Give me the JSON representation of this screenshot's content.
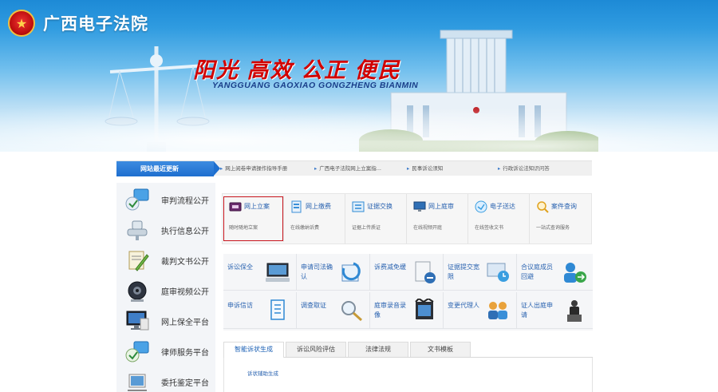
{
  "header": {
    "site_title": "广西电子法院",
    "slogan": "阳光 高效 公正 便民",
    "slogan_pinyin": "YANGGUANG  GAOXIAO GONGZHENG BIANMIN",
    "emblem_icon": "court-emblem-icon"
  },
  "notice_bar": {
    "label": "网站最近更新",
    "items": [
      "网上阅卷申请操作指导手册",
      "广西电子法院网上立案指...",
      "民事诉讼须知",
      "行政诉讼法知识问答"
    ]
  },
  "sidebar": {
    "items": [
      {
        "label": "审判流程公开",
        "icon": "trial-process-icon"
      },
      {
        "label": "执行信息公开",
        "icon": "execution-info-icon"
      },
      {
        "label": "裁判文书公开",
        "icon": "judgment-document-icon"
      },
      {
        "label": "庭审视频公开",
        "icon": "trial-video-icon"
      },
      {
        "label": "网上保全平台",
        "icon": "online-preservation-icon"
      },
      {
        "label": "律师服务平台",
        "icon": "lawyer-service-icon"
      },
      {
        "label": "委托鉴定平台",
        "icon": "appraisal-platform-icon"
      }
    ]
  },
  "services": [
    {
      "title": "网上立案",
      "desc": "随时随地立案",
      "icon": "online-filing-icon",
      "color": "#6b2b6e"
    },
    {
      "title": "网上缴费",
      "desc": "在线缴纳诉费",
      "icon": "online-payment-icon",
      "color": "#3a8fd8"
    },
    {
      "title": "证据交换",
      "desc": "证据上传质证",
      "icon": "evidence-exchange-icon",
      "color": "#2f89d4"
    },
    {
      "title": "网上庭审",
      "desc": "在线视频开庭",
      "icon": "online-trial-icon",
      "color": "#2f6fb5"
    },
    {
      "title": "电子送达",
      "desc": "在线签收文书",
      "icon": "electronic-delivery-icon",
      "color": "#3a9ee0"
    },
    {
      "title": "案件查询",
      "desc": "一站式查询服务",
      "icon": "case-query-icon",
      "color": "#e0a21e"
    }
  ],
  "features": {
    "row1": [
      {
        "label": "诉讼保全",
        "icon": "litigation-preservation-icon"
      },
      {
        "label": "申请司法确认",
        "icon": "judicial-confirmation-icon"
      },
      {
        "label": "诉费减免缓",
        "icon": "fee-reduction-icon"
      },
      {
        "label": "证据提交宽限",
        "icon": "evidence-extension-icon"
      },
      {
        "label": "合议庭成员回避",
        "icon": "panel-recusal-icon"
      }
    ],
    "row2": [
      {
        "label": "申诉信访",
        "icon": "petition-icon"
      },
      {
        "label": "调查取证",
        "icon": "investigation-icon"
      },
      {
        "label": "庭审录音录像",
        "icon": "recording-icon"
      },
      {
        "label": "变更代理人",
        "icon": "change-agent-icon"
      },
      {
        "label": "证人出庭申请",
        "icon": "witness-icon"
      }
    ]
  },
  "tabs": {
    "items": [
      "智能诉状生成",
      "诉讼风险评估",
      "法律法规",
      "文书模板"
    ],
    "active_index": 0,
    "panel_link": "诉状辅助生成"
  },
  "colors": {
    "accent_blue": "#1e6fcf",
    "link_blue": "#2a63b0",
    "slogan_red": "#d10000",
    "highlight_border": "#c8151d"
  }
}
